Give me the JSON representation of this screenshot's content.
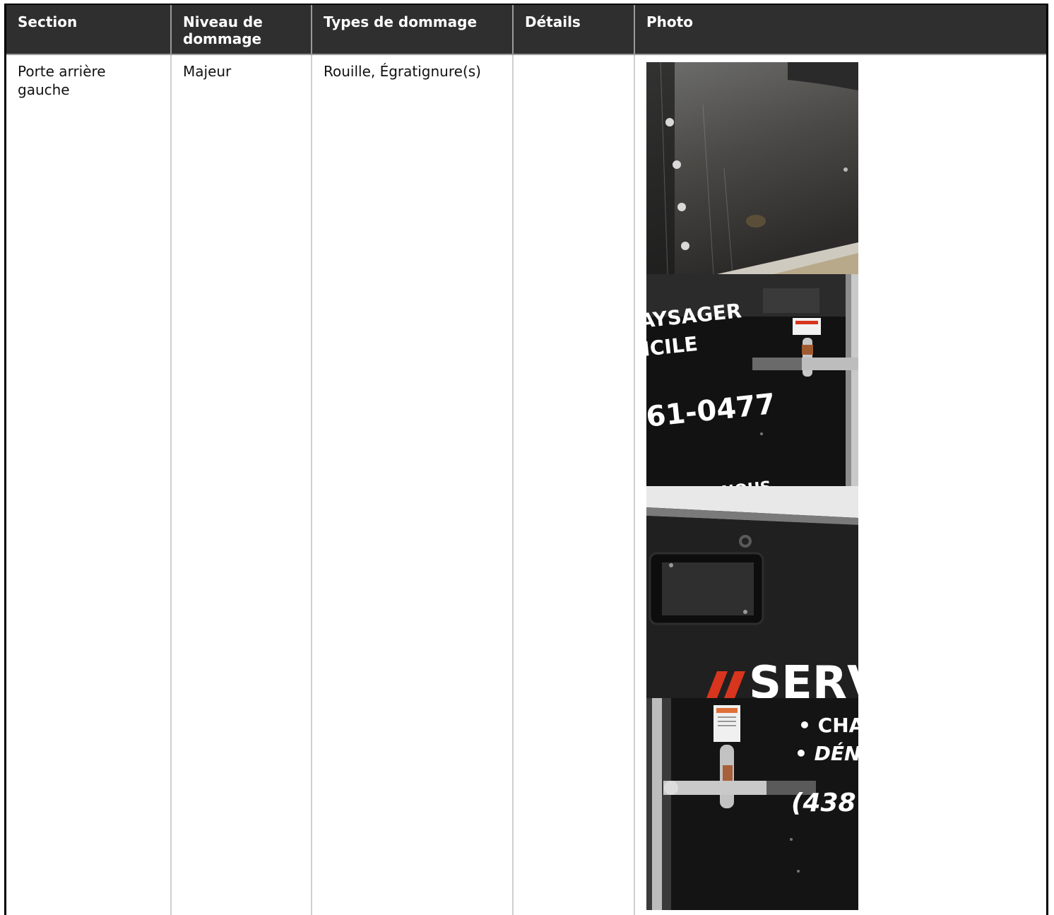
{
  "table": {
    "headers": [
      "Section",
      "Niveau de dommage",
      "Types de dommage",
      "Détails",
      "Photo"
    ],
    "rows": [
      {
        "section": "Porte arrière gauche",
        "niveau": "Majeur",
        "types": "Rouille, Égratignure(s)",
        "details": "",
        "photos": [
          {
            "name": "photo-scratched-door-panel"
          },
          {
            "name": "photo-door-latch-lettering",
            "text_1": "AYSAGER",
            "text_2": "ICILE",
            "text_3": "61-0477",
            "text_4": "NOUS"
          },
          {
            "name": "photo-license-plate-area",
            "text_1": "SERV"
          },
          {
            "name": "photo-door-handle-closeup",
            "text_1": "• CHA",
            "text_2": "• DÉNE",
            "text_3": "(438"
          }
        ]
      }
    ]
  },
  "colors": {
    "header_bg": "#2f2f2f",
    "header_text": "#ffffff",
    "border": "#000000",
    "brand_red": "#d8351e"
  }
}
